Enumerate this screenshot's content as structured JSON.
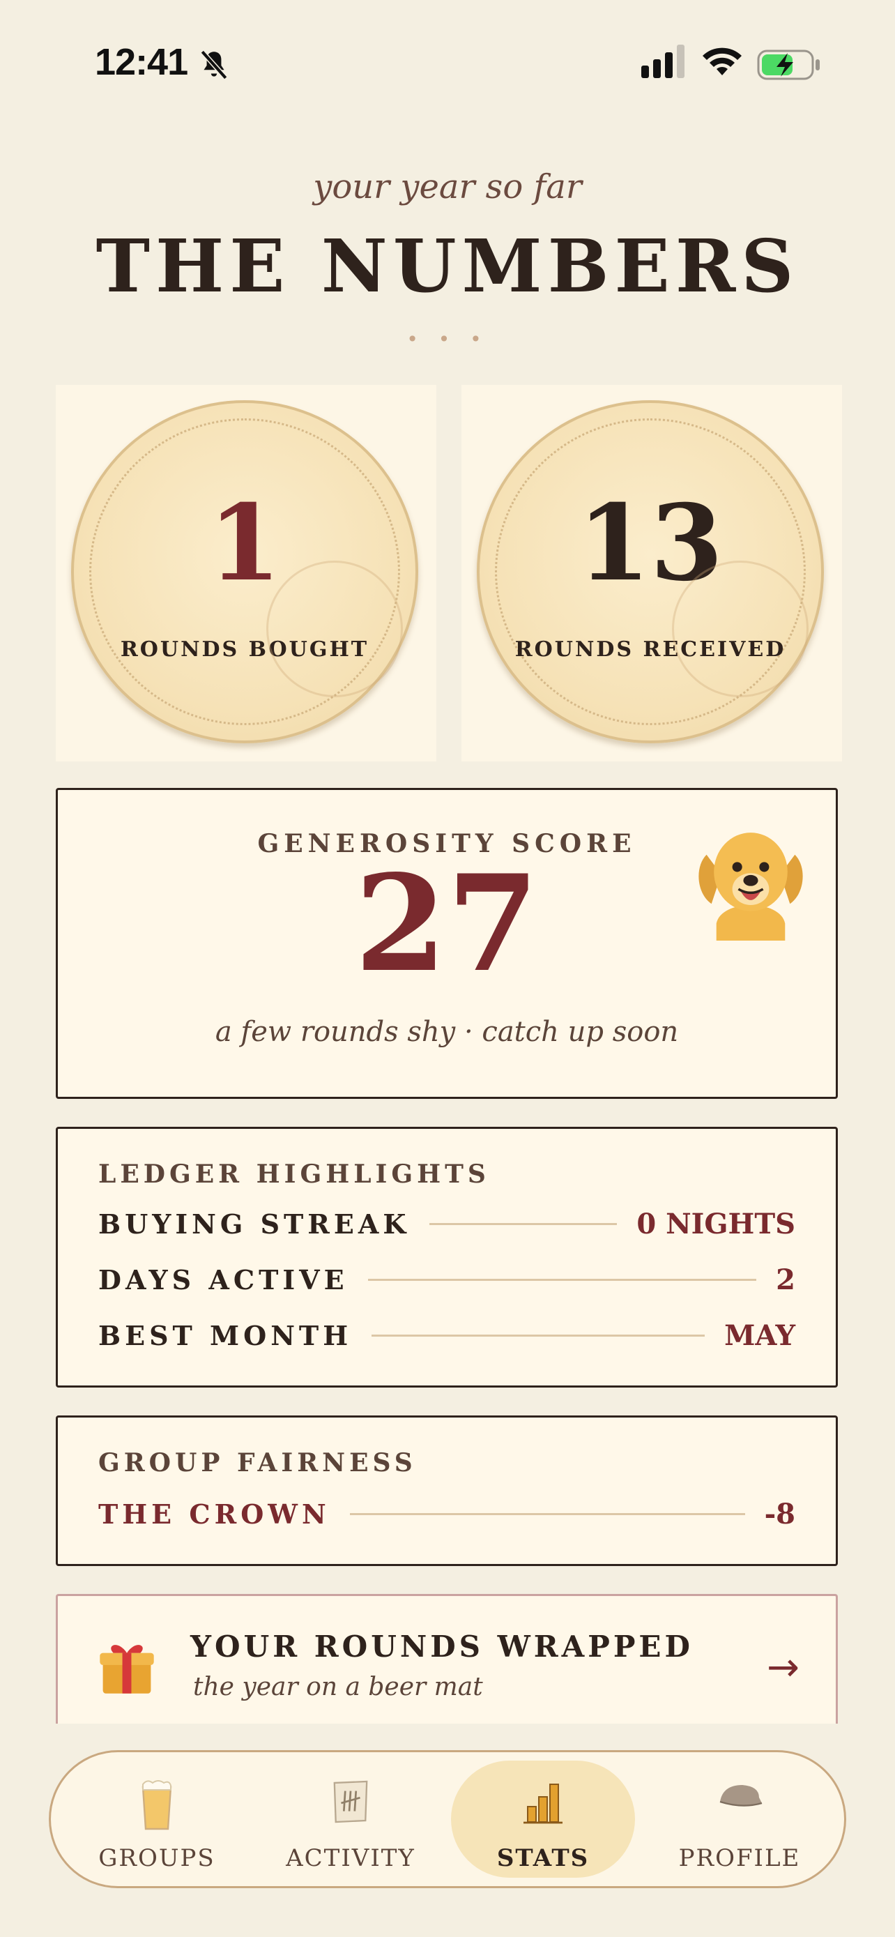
{
  "status": {
    "time": "12:41"
  },
  "header": {
    "subtitle": "your year so far",
    "title": "THE NUMBERS",
    "dots": "• • •"
  },
  "coasters": [
    {
      "number": "1",
      "label": "ROUNDS BOUGHT",
      "number_color": "#7a2a2e"
    },
    {
      "number": "13",
      "label": "ROUNDS RECEIVED",
      "number_color": "#2e221c"
    }
  ],
  "generosity": {
    "label": "GENEROSITY SCORE",
    "score": "27",
    "note": "a few rounds shy · catch up soon",
    "mascot_icon": "golden-retriever-icon"
  },
  "ledger": {
    "label": "LEDGER HIGHLIGHTS",
    "rows": [
      {
        "key": "BUYING STREAK",
        "value": "0 NIGHTS"
      },
      {
        "key": "DAYS ACTIVE",
        "value": "2"
      },
      {
        "key": "BEST MONTH",
        "value": "MAY"
      }
    ]
  },
  "fairness": {
    "label": "GROUP FAIRNESS",
    "rows": [
      {
        "key": "THE CROWN",
        "value": "-8"
      }
    ]
  },
  "wrapped": {
    "title": "YOUR ROUNDS WRAPPED",
    "subtitle": "the year on a beer mat",
    "icon": "gift-icon",
    "arrow": "→"
  },
  "tabs": [
    {
      "label": "GROUPS",
      "icon": "beer-glass-icon",
      "active": false
    },
    {
      "label": "ACTIVITY",
      "icon": "tally-note-icon",
      "active": false
    },
    {
      "label": "STATS",
      "icon": "bar-chart-icon",
      "active": true
    },
    {
      "label": "PROFILE",
      "icon": "flat-cap-icon",
      "active": false
    }
  ],
  "colors": {
    "background": "#f4efe1",
    "accent": "#7a2a2e",
    "ink": "#2e221c",
    "card": "#fff8e9"
  }
}
